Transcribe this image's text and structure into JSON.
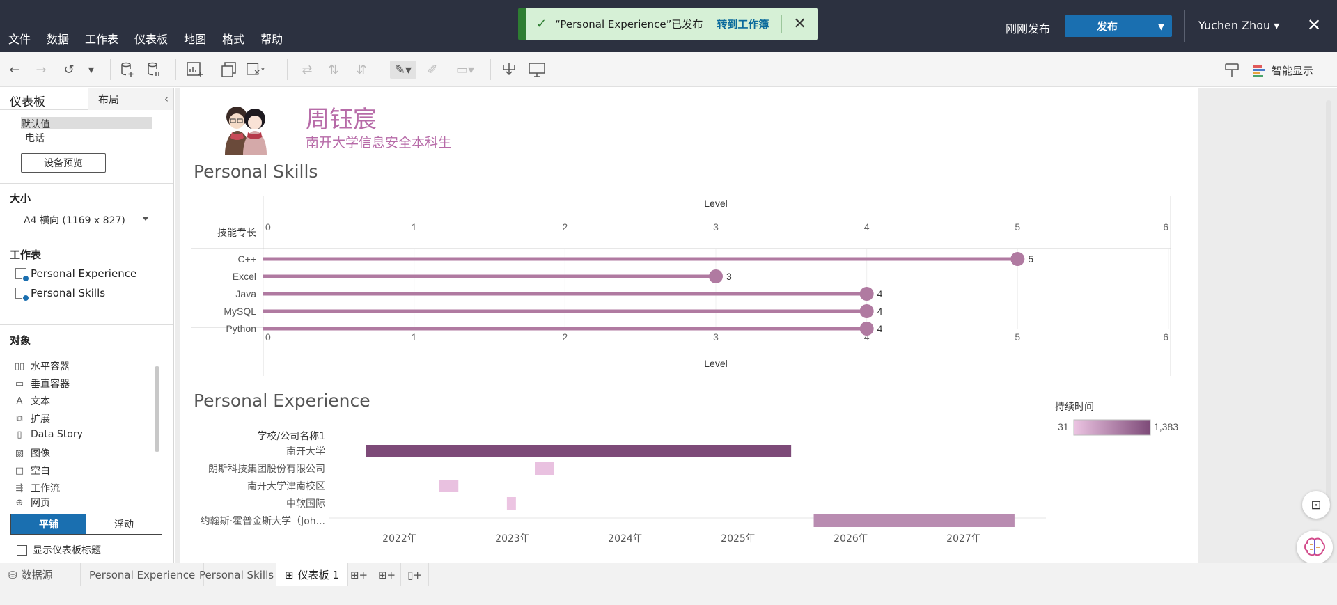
{
  "menu": [
    "文件",
    "数据",
    "工作表",
    "仪表板",
    "地图",
    "格式",
    "帮助"
  ],
  "toast": {
    "message": "“Personal Experience”已发布",
    "link": "转到工作簿"
  },
  "header": {
    "status": "刚刚发布",
    "publish_label": "发布",
    "user": "Yuchen Zhou ▾"
  },
  "toolbar": {
    "smart_display": "智能显示"
  },
  "left_panel": {
    "tab_dashboard": "仪表板",
    "tab_layout": "布局",
    "devices": [
      "默认值",
      "电话"
    ],
    "device_preview": "设备预览",
    "size_heading": "大小",
    "size_value": "A4 横向 (1169 x 827)",
    "sheets_heading": "工作表",
    "sheets": [
      "Personal Experience",
      "Personal Skills"
    ],
    "objects_heading": "对象",
    "objects": [
      {
        "icon": "horizontal-container-icon",
        "label": "水平容器"
      },
      {
        "icon": "vertical-container-icon",
        "label": "垂直容器"
      },
      {
        "icon": "text-icon",
        "label": "文本"
      },
      {
        "icon": "extension-icon",
        "label": "扩展"
      },
      {
        "icon": "data-story-icon",
        "label": "Data Story"
      },
      {
        "icon": "image-icon",
        "label": "图像"
      },
      {
        "icon": "blank-icon",
        "label": "空白"
      },
      {
        "icon": "workflow-icon",
        "label": "工作流"
      },
      {
        "icon": "web-page-icon",
        "label": "网页"
      }
    ],
    "tiled_label": "平铺",
    "floating_label": "浮动",
    "show_title_label": "显示仪表板标题"
  },
  "dashboard": {
    "name": "周钰宸",
    "subtitle": "南开大学信息安全本科生",
    "skills_title": "Personal Skills",
    "experience_title": "Personal Experience"
  },
  "chart_data": [
    {
      "type": "bar",
      "title": "Personal Skills",
      "category_header": "技能专长",
      "xlabel": "Level",
      "xlim": [
        0,
        6
      ],
      "xticks": [
        0,
        1,
        2,
        3,
        4,
        5,
        6
      ],
      "categories": [
        "C++",
        "Excel",
        "Java",
        "MySQL",
        "Python"
      ],
      "values": [
        5,
        3,
        4,
        4,
        4
      ],
      "color": "#b07aa1"
    },
    {
      "type": "bar",
      "title": "Personal Experience",
      "category_header": "学校/公司名称1",
      "categories": [
        "南开大学",
        "朗斯科技集团股份有限公司",
        "南开大学津南校区",
        "中软国际",
        "约翰斯·霍普金斯大学（Joh..."
      ],
      "x_tick_labels": [
        "2022年",
        "2023年",
        "2024年",
        "2025年",
        "2026年",
        "2027年"
      ],
      "start_year": [
        2021.7,
        2023.2,
        2022.35,
        2022.95,
        2025.67
      ],
      "end_year": [
        2025.47,
        2023.37,
        2022.52,
        2023.03,
        2027.45
      ],
      "duration_legend_title": "持续时间",
      "duration_min": "31",
      "duration_max": "1,383",
      "durations": [
        1383,
        62,
        62,
        31,
        650
      ],
      "color_low": "#ecc4e2",
      "color_high": "#7d4a78"
    }
  ],
  "bottom_tabs": [
    {
      "label": "数据源",
      "icon": "datasource-icon"
    },
    {
      "label": "Personal Experience"
    },
    {
      "label": "Personal Skills"
    },
    {
      "label": "仪表板 1",
      "active": true
    }
  ]
}
